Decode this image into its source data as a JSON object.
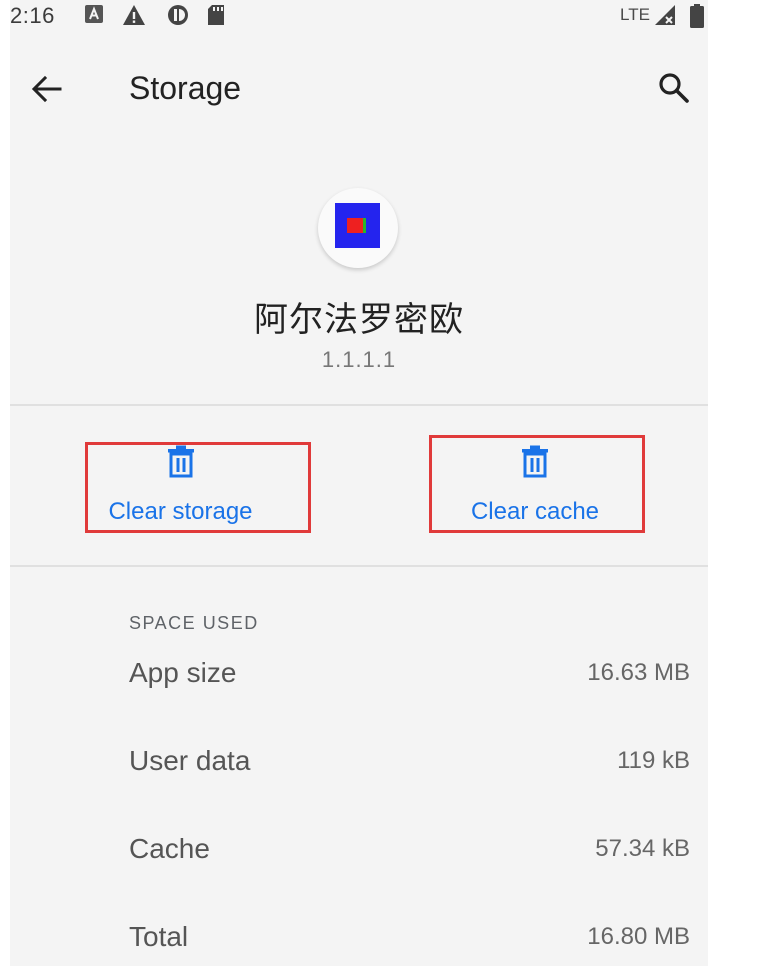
{
  "status_bar": {
    "time": "2:16",
    "network": "LTE",
    "icons": [
      "notification-a-icon",
      "warning-icon",
      "vpn-icon",
      "sd-card-icon",
      "signal-icon",
      "battery-icon"
    ]
  },
  "toolbar": {
    "title": "Storage",
    "back_icon": "arrow-left-icon",
    "search_icon": "search-icon"
  },
  "app": {
    "name": "阿尔法罗密欧",
    "version": "1.1.1.1"
  },
  "actions": {
    "clear_storage_label": "Clear storage",
    "clear_cache_label": "Clear cache",
    "icon": "trash-icon",
    "highlight_color": "#e03a3a"
  },
  "space_used": {
    "header": "SPACE USED",
    "rows": [
      {
        "label": "App size",
        "value": "16.63 MB"
      },
      {
        "label": "User data",
        "value": "119 kB"
      },
      {
        "label": "Cache",
        "value": "57.34 kB"
      },
      {
        "label": "Total",
        "value": "16.80 MB"
      }
    ]
  },
  "colors": {
    "accent": "#1a73e8",
    "background": "#f4f4f4"
  }
}
